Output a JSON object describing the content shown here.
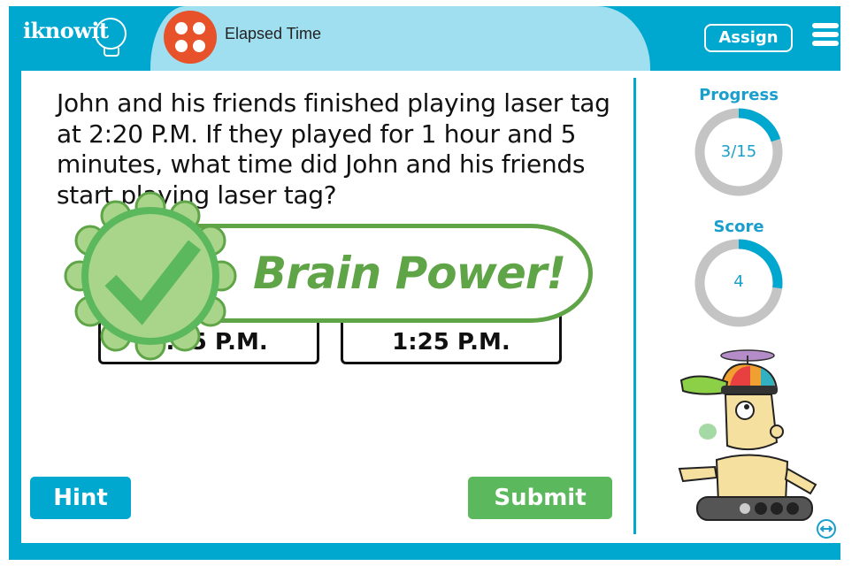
{
  "header": {
    "logo_text": "iknowit",
    "lesson_title": "Elapsed Time",
    "assign_label": "Assign",
    "menu_icon": "hamburger-menu-icon",
    "lesson_icon": "four-dots-icon"
  },
  "question": {
    "text": "John and his friends finished playing laser tag at 2:20 P.M. If they played for 1 hour and 5 minutes, what time did John and his friends start playing laser tag?"
  },
  "answers": [
    {
      "label": "1:25 P.M."
    },
    {
      "label": "1:25 P.M."
    }
  ],
  "feedback": {
    "banner_text": "Brain Power!",
    "icon": "checkmark-badge-icon"
  },
  "buttons": {
    "hint_label": "Hint",
    "submit_label": "Submit"
  },
  "sidebar": {
    "progress_label": "Progress",
    "progress_text": "3/15",
    "progress_current": 3,
    "progress_total": 15,
    "score_label": "Score",
    "score_text": "4",
    "score_fraction": 0.27,
    "mascot": "robot-mascot-image",
    "expand_icon": "expand-arrows-icon"
  },
  "colors": {
    "brand_blue": "#00a7cf",
    "light_blue": "#a0dff0",
    "success_green": "#5cb85c",
    "banner_green": "#5fa447",
    "lesson_orange": "#e8522a",
    "ring_gray": "#c4c4c4"
  }
}
